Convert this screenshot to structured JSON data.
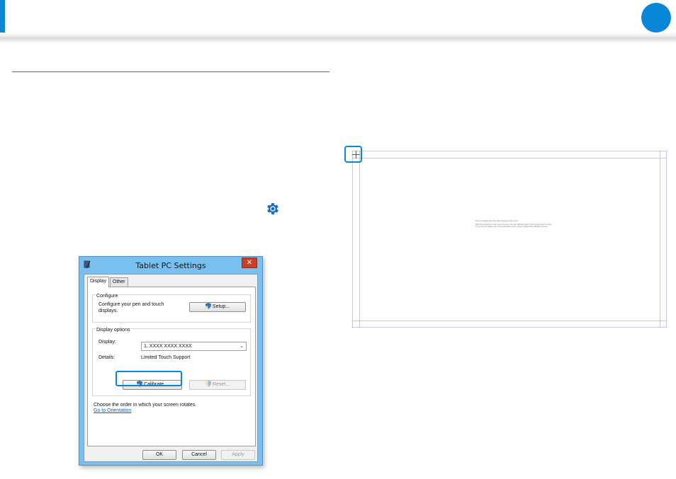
{
  "colors": {
    "accent": "#0a86d6",
    "close_button": "#c7402c",
    "link": "#0a5fb8",
    "calibration_lines": "#b6b6ea"
  },
  "icons": {
    "settings": "gear-icon",
    "window": "tablet-pc-icon",
    "uac": "uac-shield-icon",
    "close": "close-icon",
    "crosshair": "crosshair-icon"
  },
  "dialog": {
    "title": "Tablet PC Settings",
    "close_label": "✕",
    "tabs": [
      {
        "label": "Display",
        "active": true
      },
      {
        "label": "Other",
        "active": false
      }
    ],
    "configure": {
      "group_label": "Configure",
      "description": "Configure your pen and touch displays.",
      "setup_button": "Setup..."
    },
    "display_options": {
      "group_label": "Display options",
      "display_label": "Display:",
      "display_value": "1. XXXX XXXX XXXX",
      "details_label": "Details:",
      "details_value": "Limited Touch Support",
      "calibrate_button": "Calibrate...",
      "reset_button": "Reset..."
    },
    "orientation_text": "Choose the order in which your screen rotates.",
    "orientation_link": "Go to Orientation",
    "buttons": {
      "ok": "OK",
      "cancel": "Cancel",
      "apply": "Apply"
    }
  },
  "calibration_screen": {
    "instructions": [
      "Tap the crosshair each time that it appears on the screen.",
      "Right-click anywhere on the screen to return to the last calibration point. Press the Esc button to close the tool. Do not change your screen orientation until you have completed the calibration process."
    ]
  }
}
